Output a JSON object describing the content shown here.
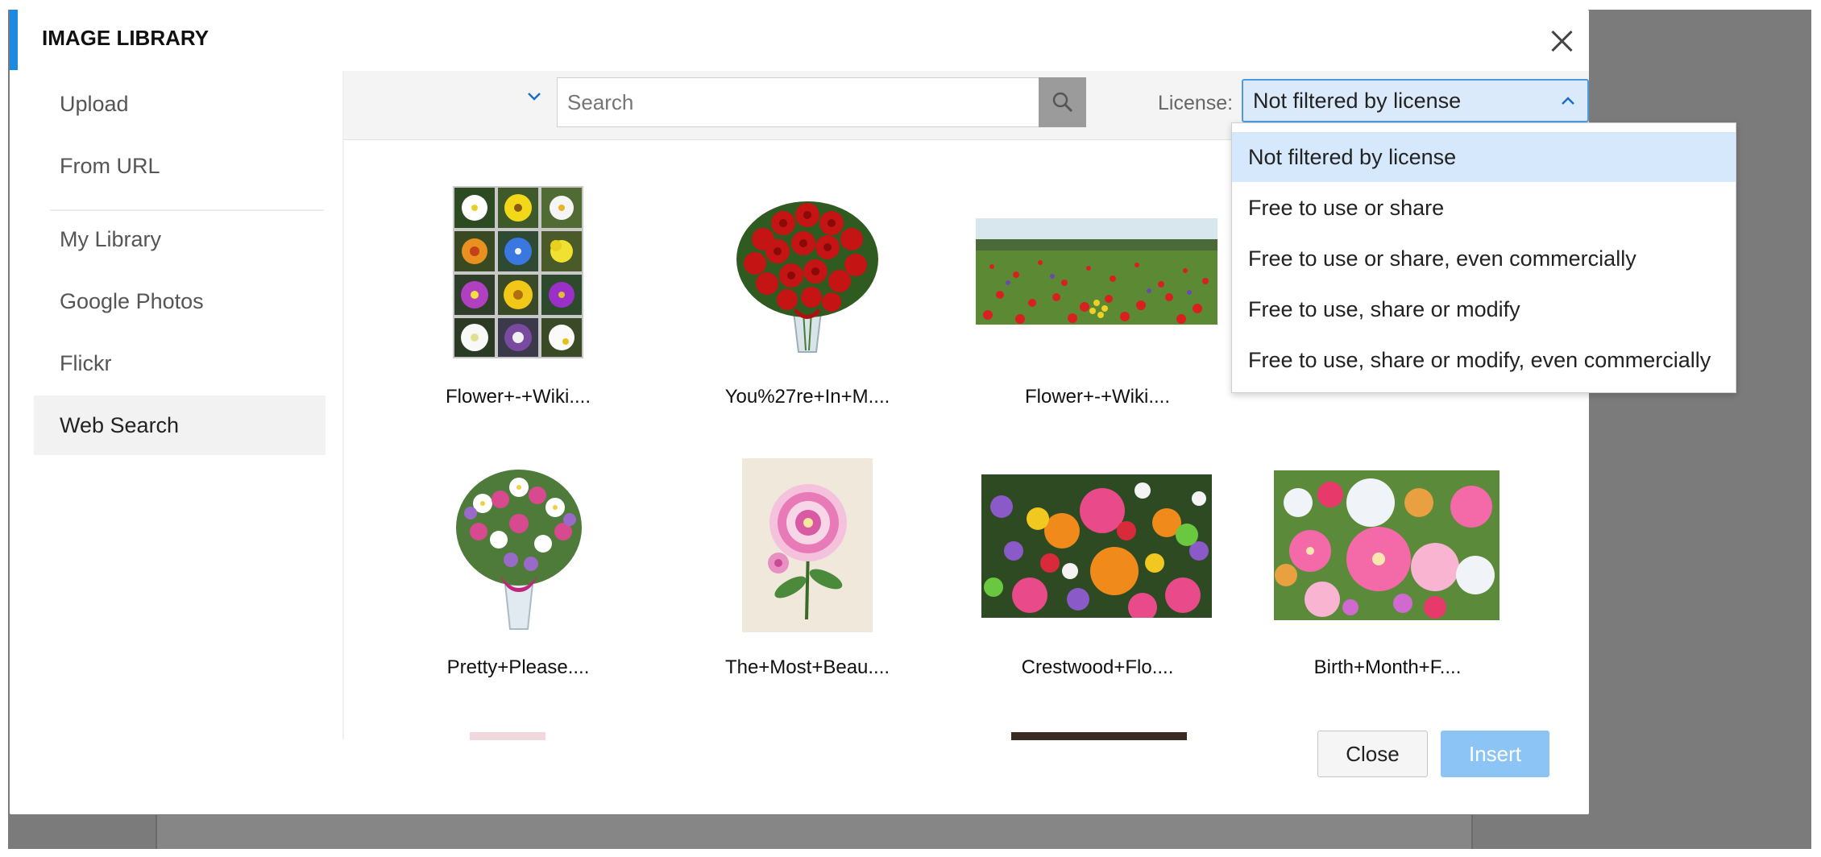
{
  "dialog": {
    "title": "IMAGE LIBRARY",
    "close_icon": "close-icon"
  },
  "sidebar": {
    "items": [
      {
        "label": "Upload"
      },
      {
        "label": "From URL"
      },
      {
        "label": "My Library"
      },
      {
        "label": "Google Photos"
      },
      {
        "label": "Flickr"
      },
      {
        "label": "Web Search"
      }
    ],
    "active": "Web Search"
  },
  "toolbar": {
    "search_placeholder": "Search",
    "search_icon": "search-icon",
    "license_label": "License:",
    "license_value": "Not filtered by license"
  },
  "license_dropdown": {
    "options": [
      "Not filtered by license",
      "Free to use or share",
      "Free to use or share, even commercially",
      "Free to use, share or modify",
      "Free to use, share or modify, even commercially"
    ],
    "selected": "Not filtered by license"
  },
  "results": [
    {
      "caption": "Flower+-+Wiki...."
    },
    {
      "caption": "You%27re+In+M...."
    },
    {
      "caption": "Flower+-+Wiki...."
    },
    {
      "caption": ""
    },
    {
      "caption": "Pretty+Please...."
    },
    {
      "caption": "The+Most+Beau...."
    },
    {
      "caption": "Crestwood+Flo...."
    },
    {
      "caption": "Birth+Month+F...."
    }
  ],
  "footer": {
    "close_label": "Close",
    "insert_label": "Insert"
  },
  "colors": {
    "accent": "#1a8be0",
    "selected_option": "#d6e8fb",
    "insert_button": "#8cc4f5",
    "search_button": "#9b9b9b"
  }
}
